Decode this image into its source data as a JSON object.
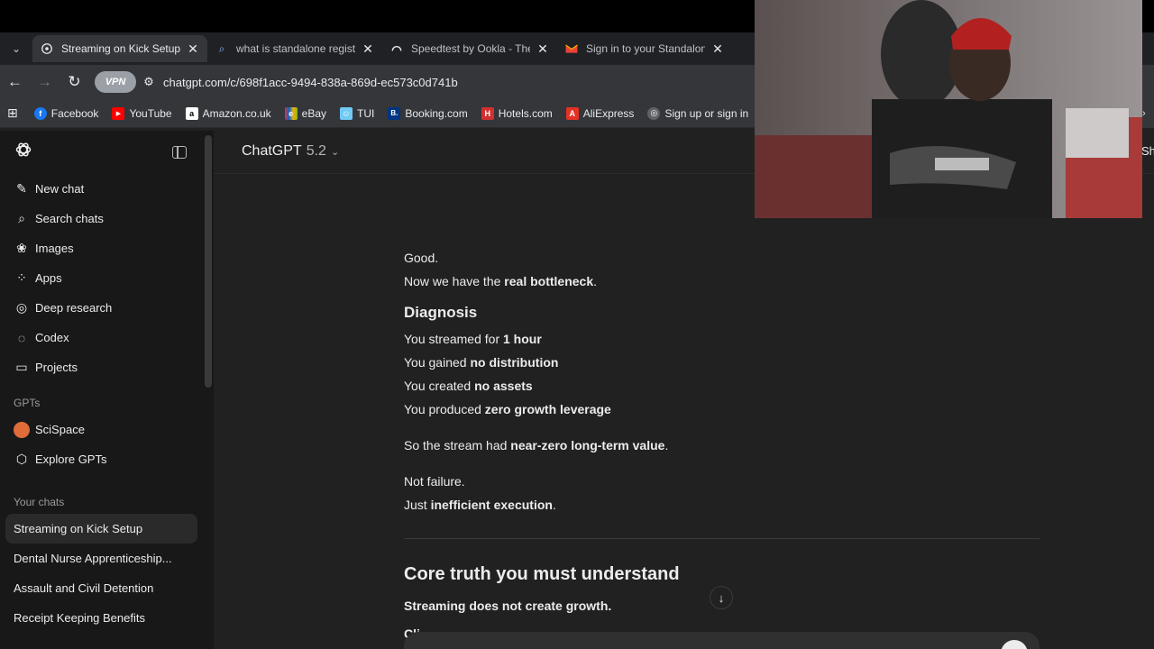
{
  "browser": {
    "tab_menu_icon": "chevron-down-icon",
    "tabs": [
      {
        "title": "Streaming on Kick Setup",
        "active": true,
        "favicon": "openai-icon"
      },
      {
        "title": "what is standalone registra",
        "active": false,
        "favicon": "search-icon"
      },
      {
        "title": "Speedtest by Ookla - The G",
        "active": false,
        "favicon": "ookla-icon"
      },
      {
        "title": "Sign in to your Standalone",
        "active": false,
        "favicon": "gmail-icon"
      }
    ],
    "vpn_label": "VPN",
    "url": "chatgpt.com/c/698f1acc-9494-838a-869d-ec573c0d741b",
    "bookmarks": [
      {
        "label": "Facebook",
        "icon": "facebook-icon",
        "color": "#1877f2",
        "glyph": "f"
      },
      {
        "label": "YouTube",
        "icon": "youtube-icon",
        "color": "#ff0000",
        "glyph": "▶"
      },
      {
        "label": "Amazon.co.uk",
        "icon": "amazon-icon",
        "color": "#ffffff",
        "glyph": "a"
      },
      {
        "label": "eBay",
        "icon": "ebay-icon",
        "color": "#e53238",
        "glyph": "e"
      },
      {
        "label": "TUI",
        "icon": "tui-icon",
        "color": "#70cbf4",
        "glyph": "☺"
      },
      {
        "label": "Booking.com",
        "icon": "booking-icon",
        "color": "#003580",
        "glyph": "B."
      },
      {
        "label": "Hotels.com",
        "icon": "hotels-icon",
        "color": "#d32f2f",
        "glyph": "H"
      },
      {
        "label": "AliExpress",
        "icon": "aliexpress-icon",
        "color": "#e43225",
        "glyph": "A"
      },
      {
        "label": "Sign up or sign in",
        "icon": "globe-icon",
        "color": "#5f6368",
        "glyph": "◎"
      }
    ]
  },
  "sidebar": {
    "nav": [
      {
        "label": "New chat",
        "icon": "edit-icon",
        "glyph": "✎"
      },
      {
        "label": "Search chats",
        "icon": "search-icon",
        "glyph": "⌕"
      },
      {
        "label": "Images",
        "icon": "images-icon",
        "glyph": "❀"
      },
      {
        "label": "Apps",
        "icon": "apps-icon",
        "glyph": "⁘"
      },
      {
        "label": "Deep research",
        "icon": "deep-research-icon",
        "glyph": "◎"
      },
      {
        "label": "Codex",
        "icon": "codex-icon",
        "glyph": "◌"
      },
      {
        "label": "Projects",
        "icon": "folder-icon",
        "glyph": "▭"
      }
    ],
    "gpts_heading": "GPTs",
    "gpts": [
      {
        "label": "SciSpace",
        "icon": "scispace-icon"
      },
      {
        "label": "Explore GPTs",
        "icon": "cube-icon",
        "glyph": "⬡"
      }
    ],
    "chats_heading": "Your chats",
    "chats": [
      {
        "label": "Streaming on Kick Setup",
        "active": true
      },
      {
        "label": "Dental Nurse Apprenticeship...",
        "active": false
      },
      {
        "label": "Assault and Civil Detention",
        "active": false
      },
      {
        "label": "Receipt Keeping Benefits",
        "active": false
      }
    ]
  },
  "main": {
    "model_name": "ChatGPT",
    "model_version": "5.2",
    "message": {
      "l1": "Good.",
      "l2_pre": "Now we have the ",
      "l2_bold": "real bottleneck",
      "l2_post": ".",
      "diagnosis_heading": "Diagnosis",
      "d1_pre": "You streamed for ",
      "d1_bold": "1 hour",
      "d2_pre": "You gained ",
      "d2_bold": "no distribution",
      "d3_pre": "You created ",
      "d3_bold": "no assets",
      "d4_pre": "You produced ",
      "d4_bold": "zero growth leverage",
      "s1_pre": "So the stream had ",
      "s1_bold": "near-zero long-term value",
      "s1_post": ".",
      "n1": "Not failure.",
      "n2_pre": "Just ",
      "n2_bold": "inefficient execution",
      "n2_post": ".",
      "core_heading": "Core truth you must understand",
      "core_line": "Streaming does not create growth.",
      "partial": "Cli"
    }
  }
}
